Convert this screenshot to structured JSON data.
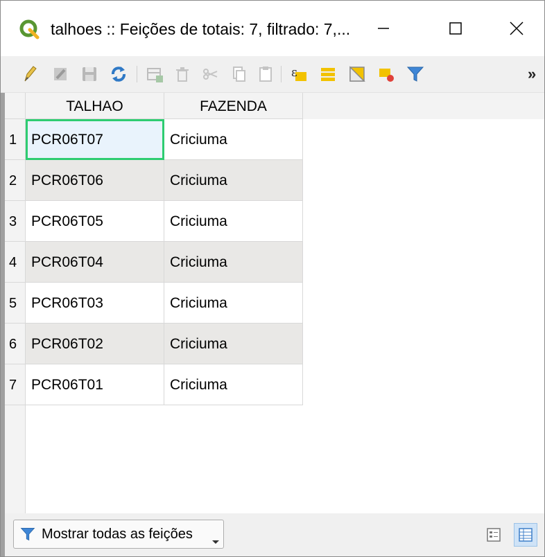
{
  "window": {
    "title": "talhoes :: Feições de totais: 7, filtrado: 7,...",
    "minimize_glyph": "—",
    "maximize_glyph": "☐",
    "close_glyph": "✕"
  },
  "toolbar": {
    "icons": [
      "pencil-icon",
      "multi-edit-icon",
      "save-icon",
      "reload-icon",
      "add-feature-icon",
      "delete-feature-icon",
      "cut-icon",
      "copy-icon",
      "paste-icon",
      "expression-select-icon",
      "select-all-icon",
      "invert-selection-icon",
      "deselect-icon",
      "filter-icon"
    ],
    "more_label": "»"
  },
  "table": {
    "columns": [
      "TALHAO",
      "FAZENDA"
    ],
    "rows": [
      {
        "num": "1",
        "talhao": "PCR06T07",
        "fazenda": "Criciuma"
      },
      {
        "num": "2",
        "talhao": "PCR06T06",
        "fazenda": "Criciuma"
      },
      {
        "num": "3",
        "talhao": "PCR06T05",
        "fazenda": "Criciuma"
      },
      {
        "num": "4",
        "talhao": "PCR06T04",
        "fazenda": "Criciuma"
      },
      {
        "num": "5",
        "talhao": "PCR06T03",
        "fazenda": "Criciuma"
      },
      {
        "num": "6",
        "talhao": "PCR06T02",
        "fazenda": "Criciuma"
      },
      {
        "num": "7",
        "talhao": "PCR06T01",
        "fazenda": "Criciuma"
      }
    ]
  },
  "bottom": {
    "filter_label": "Mostrar todas as feições",
    "view_modes": [
      "form-view-icon",
      "table-view-icon"
    ]
  },
  "colors": {
    "focus_outline": "#2ecc71",
    "alt_row": "#e9e8e6",
    "qgis_green": "#589632"
  }
}
